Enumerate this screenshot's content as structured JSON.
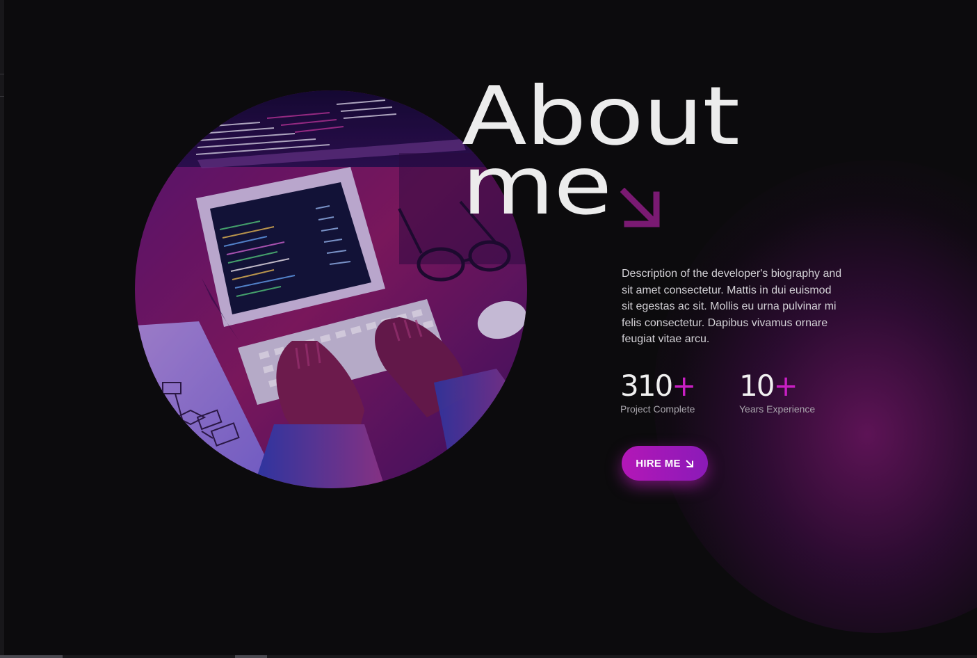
{
  "about": {
    "title_line1": "About",
    "title_line2": "me",
    "arrow_icon": "arrow-down-right-icon",
    "bio": "Description of the developer's biography and sit amet consectetur. Mattis in dui euismod sit egestas ac sit. Mollis eu urna pulvinar mi felis consectetur. Dapibus vivamus ornare feugiat vitae arcu.",
    "image": "developer-typing-keyboard-photo"
  },
  "stats": [
    {
      "number": "310",
      "suffix": "+",
      "label": "Project Complete"
    },
    {
      "number": "10",
      "suffix": "+",
      "label": "Years Experience"
    }
  ],
  "cta": {
    "label": "HIRE ME",
    "icon": "arrow-down-right-icon"
  },
  "colors": {
    "background": "#0c0b0d",
    "accent": "#c81fc3",
    "button_start": "#b317b7",
    "button_end": "#8b1ab8",
    "arrow": "#7a1a72",
    "text": "#ececec"
  }
}
